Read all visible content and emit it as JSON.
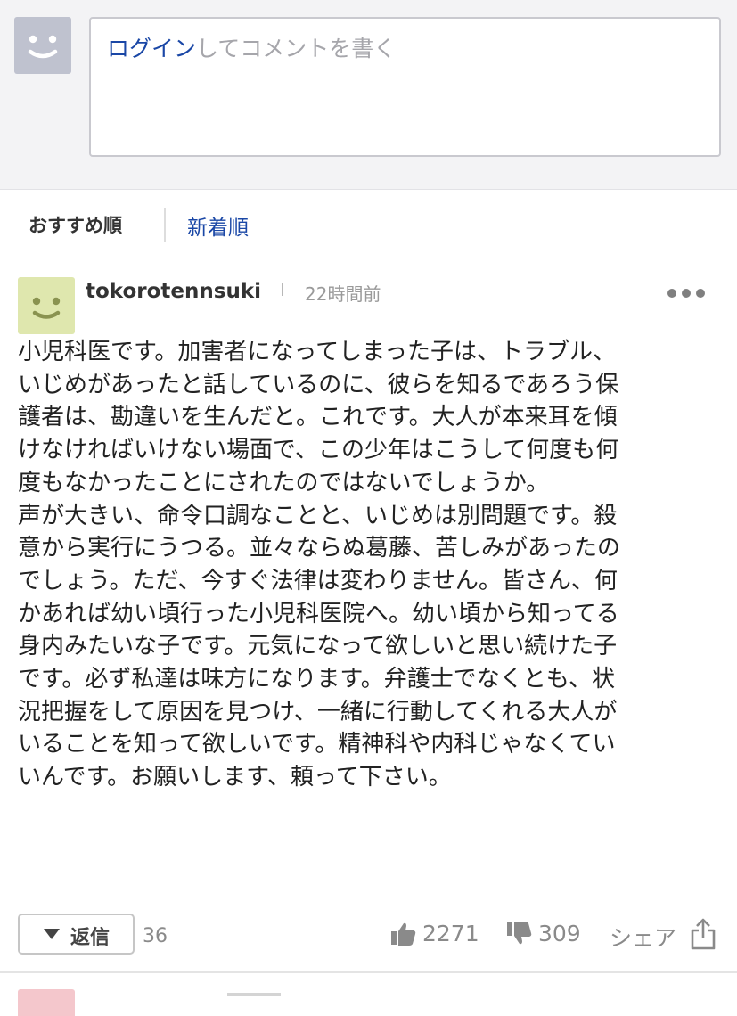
{
  "composer": {
    "login_link": "ログイン",
    "placeholder_rest": "してコメントを書く"
  },
  "sort": {
    "recommended": "おすすめ順",
    "newest": "新着順"
  },
  "comment": {
    "username": "tokorotennsuki",
    "timestamp": "22時間前",
    "body": [
      "小児科医です。加害者になってしまった子は、トラブル、\nいじめがあったと話しているのに、彼らを知るであろう保\n護者は、勘違いを生んだと。これです。大人が本来耳を傾\nけなければいけない場面で、この少年はこうして何度も何\n度もなかったことにされたのではないでしょうか。",
      "声が大きい、命令口調なことと、いじめは別問題です。殺\n意から実行にうつる。並々ならぬ葛藤、苦しみがあったの\nでしょう。ただ、今すぐ法律は変わりません。皆さん、何\nかあれば幼い頃行った小児科医院へ。幼い頃から知ってる\n身内みたいな子です。元気になって欲しいと思い続けた子\nです。必ず私達は味方になります。弁護士でなくとも、状\n況把握をして原因を見つけ、一緒に行動してくれる大人が\nいることを知って欲しいです。精神科や内科じゃなくてい\nいんです。お願いします、頼って下さい。"
    ],
    "reply_label": "返信",
    "reply_count": "36",
    "likes": "2271",
    "dislikes": "309",
    "share_label": "シェア"
  },
  "colors": {
    "link_blue": "#1a47a6",
    "muted_gray": "#8a8a8a",
    "own_avatar": "#bfc2cf",
    "user_avatar": "#dfe7ae",
    "next_avatar": "#f4c7cc"
  },
  "icons": {
    "own_avatar": "smiley-face-icon",
    "user_avatar": "smiley-face-icon",
    "more": "more-dots-icon",
    "reply": "triangle-down-icon",
    "like": "thumbs-up-icon",
    "dislike": "thumbs-down-icon",
    "share": "share-icon"
  }
}
